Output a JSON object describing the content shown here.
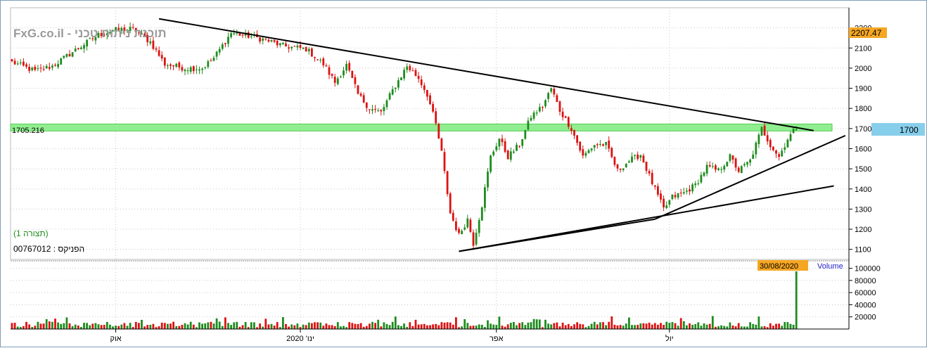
{
  "watermark": "FxG.co.il - תוכנת ניתוח טכני",
  "legend": {
    "display_label": "(תצורה 1)",
    "instrument_label": "הפניקס : 00767012"
  },
  "last_price_tag": "2207.47",
  "level_label_left": "1705.216",
  "level_label_right": "1700",
  "volume": {
    "date_tag": "30/08/2020",
    "label": "Volume"
  },
  "colors": {
    "up": "#1e8c1e",
    "down": "#dd1111",
    "band": "#90ee90",
    "price_tag": "#f5a623",
    "level_tag": "#87ceeb",
    "trendline": "#000000",
    "grid": "#c8c8c8"
  },
  "chart_data": [
    {
      "type": "candlestick",
      "title": "",
      "price_ylim": [
        1050,
        2300
      ],
      "y_ticks": [
        1100,
        1200,
        1300,
        1400,
        1500,
        1600,
        1700,
        1800,
        1900,
        2000,
        2100,
        2200
      ],
      "x_ticks": [
        {
          "label": "אוק",
          "index": 36
        },
        {
          "label": "ינו' 2020",
          "index": 100
        },
        {
          "label": "אפר",
          "index": 168
        },
        {
          "label": "יול",
          "index": 228
        }
      ],
      "horizontal_level": 1705.216,
      "anchors": [
        {
          "i": 0,
          "p": 2030
        },
        {
          "i": 8,
          "p": 1985
        },
        {
          "i": 14,
          "p": 2010
        },
        {
          "i": 22,
          "p": 2090
        },
        {
          "i": 30,
          "p": 2165
        },
        {
          "i": 36,
          "p": 2190
        },
        {
          "i": 42,
          "p": 2195
        },
        {
          "i": 48,
          "p": 2130
        },
        {
          "i": 53,
          "p": 2020
        },
        {
          "i": 60,
          "p": 2000
        },
        {
          "i": 66,
          "p": 2000
        },
        {
          "i": 70,
          "p": 2050
        },
        {
          "i": 76,
          "p": 2175
        },
        {
          "i": 82,
          "p": 2160
        },
        {
          "i": 88,
          "p": 2140
        },
        {
          "i": 94,
          "p": 2110
        },
        {
          "i": 102,
          "p": 2095
        },
        {
          "i": 108,
          "p": 2020
        },
        {
          "i": 112,
          "p": 1930
        },
        {
          "i": 116,
          "p": 2015
        },
        {
          "i": 120,
          "p": 1870
        },
        {
          "i": 124,
          "p": 1800
        },
        {
          "i": 128,
          "p": 1780
        },
        {
          "i": 132,
          "p": 1890
        },
        {
          "i": 137,
          "p": 2010
        },
        {
          "i": 141,
          "p": 1950
        },
        {
          "i": 144,
          "p": 1870
        },
        {
          "i": 147,
          "p": 1720
        },
        {
          "i": 149,
          "p": 1580
        },
        {
          "i": 152,
          "p": 1280
        },
        {
          "i": 155,
          "p": 1170
        },
        {
          "i": 158,
          "p": 1250
        },
        {
          "i": 160,
          "p": 1130
        },
        {
          "i": 163,
          "p": 1320
        },
        {
          "i": 166,
          "p": 1560
        },
        {
          "i": 169,
          "p": 1650
        },
        {
          "i": 172,
          "p": 1560
        },
        {
          "i": 176,
          "p": 1620
        },
        {
          "i": 180,
          "p": 1760
        },
        {
          "i": 184,
          "p": 1810
        },
        {
          "i": 187,
          "p": 1900
        },
        {
          "i": 190,
          "p": 1790
        },
        {
          "i": 194,
          "p": 1700
        },
        {
          "i": 198,
          "p": 1560
        },
        {
          "i": 202,
          "p": 1620
        },
        {
          "i": 206,
          "p": 1620
        },
        {
          "i": 210,
          "p": 1490
        },
        {
          "i": 214,
          "p": 1540
        },
        {
          "i": 218,
          "p": 1570
        },
        {
          "i": 222,
          "p": 1430
        },
        {
          "i": 226,
          "p": 1300
        },
        {
          "i": 229,
          "p": 1360
        },
        {
          "i": 233,
          "p": 1380
        },
        {
          "i": 237,
          "p": 1420
        },
        {
          "i": 241,
          "p": 1510
        },
        {
          "i": 245,
          "p": 1490
        },
        {
          "i": 249,
          "p": 1560
        },
        {
          "i": 252,
          "p": 1490
        },
        {
          "i": 256,
          "p": 1540
        },
        {
          "i": 260,
          "p": 1700
        },
        {
          "i": 263,
          "p": 1620
        },
        {
          "i": 266,
          "p": 1560
        },
        {
          "i": 269,
          "p": 1650
        },
        {
          "i": 272,
          "p": 1705
        }
      ],
      "candle_count": 273,
      "trendlines": [
        {
          "x1": 51,
          "y1": 2245,
          "x2": 278,
          "y2": 1690
        },
        {
          "x1": 155,
          "y1": 1090,
          "x2": 223,
          "y2": 1250
        },
        {
          "x1": 155,
          "y1": 1090,
          "x2": 285,
          "y2": 1415
        },
        {
          "x1": 223,
          "y1": 1250,
          "x2": 289,
          "y2": 1665
        }
      ],
      "volume_ylim": [
        0,
        110000
      ],
      "volume_ticks": [
        20000,
        40000,
        60000,
        80000,
        100000
      ],
      "volume_spike": {
        "index": 272,
        "value": 95000
      },
      "volume_typical_max": 12000
    }
  ]
}
